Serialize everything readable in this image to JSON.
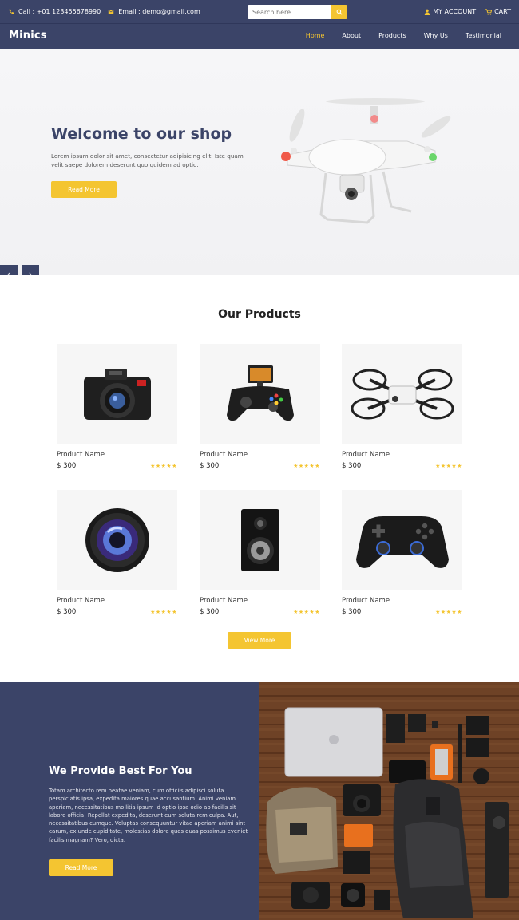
{
  "topbar": {
    "call": "Call : +01 123455678990",
    "email": "Email : demo@gmail.com",
    "search_placeholder": "Search here...",
    "account": "MY ACCOUNT",
    "cart": "CART"
  },
  "nav": {
    "brand": "Minics",
    "items": [
      "Home",
      "About",
      "Products",
      "Why Us",
      "Testimonial"
    ]
  },
  "hero": {
    "title": "Welcome to our shop",
    "text": "Lorem ipsum dolor sit amet, consectetur adipisicing elit. Iste quam velit saepe dolorem deserunt quo quidem ad optio.",
    "button": "Read More",
    "prev": "‹",
    "next": "›"
  },
  "products": {
    "title": "Our Products",
    "items": [
      {
        "name": "Product Name",
        "price": "$ 300",
        "stars": "★★★★★",
        "icon": "camera"
      },
      {
        "name": "Product Name",
        "price": "$ 300",
        "stars": "★★★★★",
        "icon": "gamepad-phone"
      },
      {
        "name": "Product Name",
        "price": "$ 300",
        "stars": "★★★★★",
        "icon": "mini-drone"
      },
      {
        "name": "Product Name",
        "price": "$ 300",
        "stars": "★★★★★",
        "icon": "lens"
      },
      {
        "name": "Product Name",
        "price": "$ 300",
        "stars": "★★★★★",
        "icon": "speaker"
      },
      {
        "name": "Product Name",
        "price": "$ 300",
        "stars": "★★★★★",
        "icon": "controller"
      }
    ],
    "view_more": "View More"
  },
  "about": {
    "title": "We Provide Best For You",
    "text": "Totam architecto rem beatae veniam, cum officiis adipisci soluta perspiciatis ipsa, expedita maiores quae accusantium. Animi veniam aperiam, necessitatibus mollitia ipsum id optio ipsa odio ab facilis sit labore officia! Repellat expedita, deserunt eum soluta rem culpa. Aut, necessitatibus cumque. Voluptas consequuntur vitae aperiam animi sint earum, ex unde cupiditate, molestias dolore quos quas possimus eveniet facilis magnam? Vero, dicta.",
    "button": "Read More"
  },
  "colors": {
    "navy": "#3b4468",
    "accent": "#f4c531"
  }
}
